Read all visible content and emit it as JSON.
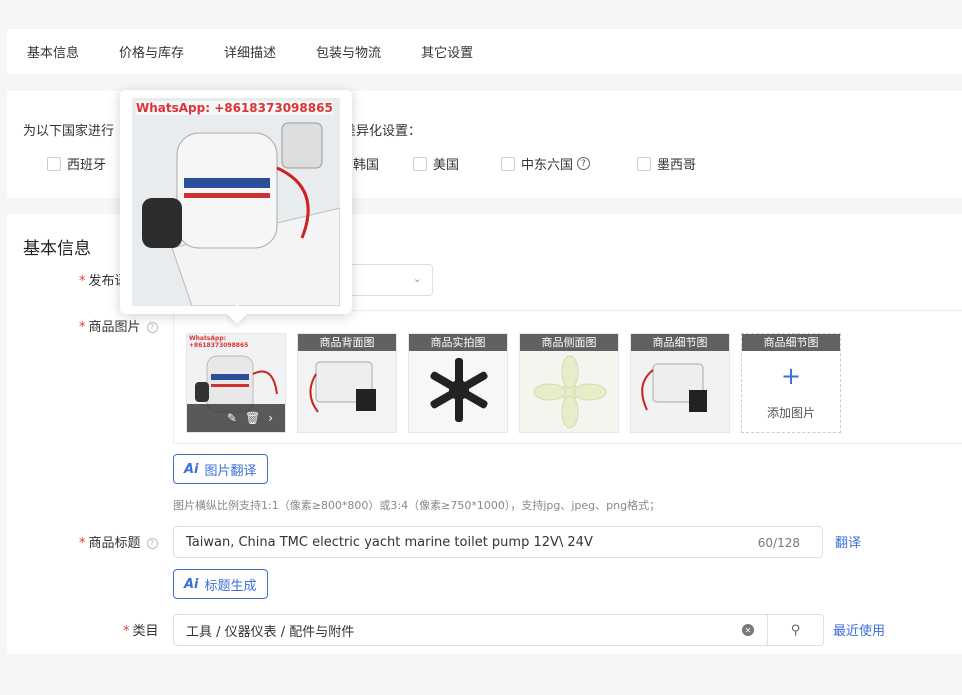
{
  "tabs": [
    "基本信息",
    "价格与库存",
    "详细描述",
    "包装与物流",
    "其它设置"
  ],
  "country": {
    "prefix": "为以下国家进行",
    "suffix": "差异化设置：",
    "options": [
      "西班牙",
      "韩国",
      "美国",
      "中东六国",
      "墨西哥"
    ]
  },
  "section_title": "基本信息",
  "labels": {
    "publish": "发布语",
    "images": "商品图片",
    "title": "商品标题",
    "category": "类目"
  },
  "images": {
    "watermark": "WhatsApp: +8618373098865",
    "captions": [
      "商品背面图",
      "商品实拍图",
      "商品侧面图",
      "商品细节图",
      "商品细节图"
    ],
    "add_label": "添加图片",
    "tool_icons": [
      "edit-icon",
      "trash-icon",
      "chevron-right-icon"
    ]
  },
  "buttons": {
    "ai_badge": "Ai",
    "image_translate": "图片翻译",
    "title_generate": "标题生成"
  },
  "hint": "图片横纵比例支持1:1（像素≥800*800）或3:4（像素≥750*1000），支持jpg、jpeg、png格式；",
  "title_input": {
    "value": "Taiwan, China TMC electric yacht marine toilet pump 12V\\ 24V",
    "counter": "60/128",
    "translate": "翻译"
  },
  "category_input": {
    "value": "工具 / 仪器仪表 / 配件与附件",
    "recent": "最近使用"
  },
  "popover": {
    "watermark": "WhatsApp: +8618373098865"
  },
  "colors": {
    "accent": "#3b6fd8",
    "required": "#e4393c"
  }
}
